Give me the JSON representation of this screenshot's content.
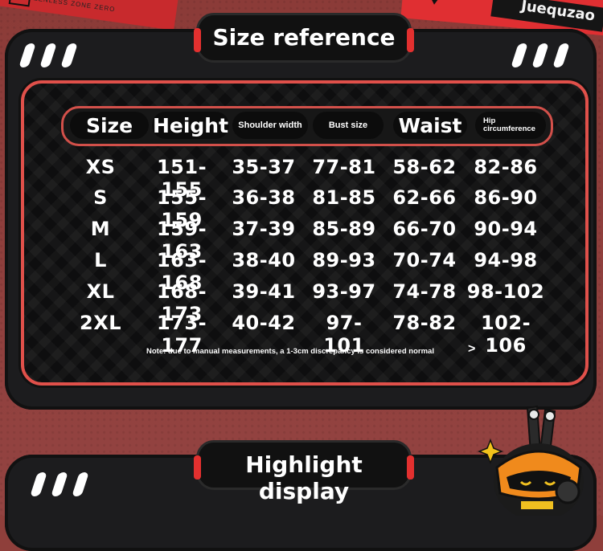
{
  "top_banner": {
    "brand": "Juequzao",
    "logo_mark": "Z",
    "tape_text": "ZENLESS ZONE ZERO"
  },
  "size_section": {
    "title": "Size reference",
    "headers": [
      "Size",
      "Height",
      "Shoulder width",
      "Bust size",
      "Waist",
      "Hip circumference"
    ],
    "rows": [
      [
        "XS",
        "151-155",
        "35-37",
        "77-81",
        "58-62",
        "82-86"
      ],
      [
        "S",
        "155-159",
        "36-38",
        "81-85",
        "62-66",
        "86-90"
      ],
      [
        "M",
        "159-163",
        "37-39",
        "85-89",
        "66-70",
        "90-94"
      ],
      [
        "L",
        "163-168",
        "38-40",
        "89-93",
        "70-74",
        "94-98"
      ],
      [
        "XL",
        "168-173",
        "39-41",
        "93-97",
        "74-78",
        "98-102"
      ],
      [
        "2XL",
        "173-177",
        "40-42",
        "97-101",
        "78-82",
        "102-106"
      ]
    ],
    "note": "Note: due to manual measurements, a 1-3cm discrepancy is considered normal",
    "note_arrow": ">"
  },
  "highlight_section": {
    "title": "Highlight display"
  },
  "colors": {
    "accent_red": "#e3302f",
    "panel_dark": "#1c1c1e",
    "background": "#8f3f3b"
  },
  "icons": [
    "slash-decoration-icon",
    "bunny-mascot-icon",
    "sparkle-icon",
    "chevron-right-icon"
  ]
}
